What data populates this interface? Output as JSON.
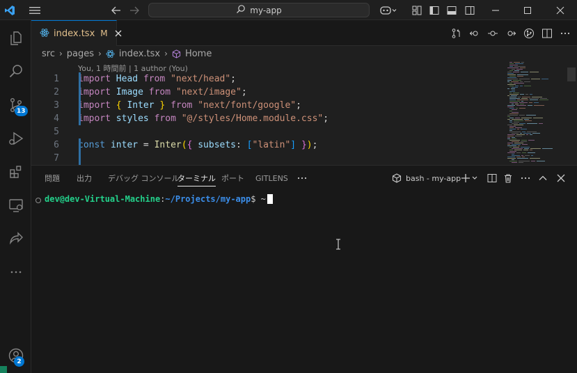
{
  "window": {
    "search_text": "my-app"
  },
  "activity": {
    "source_control_badge": "13",
    "accounts_badge": "2"
  },
  "tab": {
    "name": "index.tsx",
    "modified": "M"
  },
  "breadcrumb": {
    "items": [
      "src",
      "pages",
      "index.tsx",
      "Home"
    ]
  },
  "editor": {
    "codelens": "You, 1 時間前 | 1 author (You)",
    "line_numbers": [
      "1",
      "2",
      "3",
      "4",
      "5",
      "6",
      "7"
    ],
    "lines": [
      [
        [
          "kw2",
          "import"
        ],
        [
          "pl",
          " "
        ],
        [
          "id",
          "Head"
        ],
        [
          "pl",
          " "
        ],
        [
          "kw2",
          "from"
        ],
        [
          "pl",
          " "
        ],
        [
          "str",
          "\"next/head\""
        ],
        [
          "pl",
          ";"
        ]
      ],
      [
        [
          "kw2",
          "import"
        ],
        [
          "pl",
          " "
        ],
        [
          "id",
          "Image"
        ],
        [
          "pl",
          " "
        ],
        [
          "kw2",
          "from"
        ],
        [
          "pl",
          " "
        ],
        [
          "str",
          "\"next/image\""
        ],
        [
          "pl",
          ";"
        ]
      ],
      [
        [
          "kw2",
          "import"
        ],
        [
          "pl",
          " "
        ],
        [
          "br1",
          "{"
        ],
        [
          "pl",
          " "
        ],
        [
          "id",
          "Inter"
        ],
        [
          "pl",
          " "
        ],
        [
          "br1",
          "}"
        ],
        [
          "pl",
          " "
        ],
        [
          "kw2",
          "from"
        ],
        [
          "pl",
          " "
        ],
        [
          "str",
          "\"next/font/google\""
        ],
        [
          "pl",
          ";"
        ]
      ],
      [
        [
          "kw2",
          "import"
        ],
        [
          "pl",
          " "
        ],
        [
          "id",
          "styles"
        ],
        [
          "pl",
          " "
        ],
        [
          "kw2",
          "from"
        ],
        [
          "pl",
          " "
        ],
        [
          "str",
          "\"@/styles/Home.module.css\""
        ],
        [
          "pl",
          ";"
        ]
      ],
      [],
      [
        [
          "kw",
          "const"
        ],
        [
          "pl",
          " "
        ],
        [
          "id",
          "inter"
        ],
        [
          "pl",
          " = "
        ],
        [
          "fn",
          "Inter"
        ],
        [
          "br1",
          "("
        ],
        [
          "br2",
          "{"
        ],
        [
          "pl",
          " "
        ],
        [
          "id",
          "subsets"
        ],
        [
          "pl",
          ": "
        ],
        [
          "br3",
          "["
        ],
        [
          "str",
          "\"latin\""
        ],
        [
          "br3",
          "]"
        ],
        [
          "pl",
          " "
        ],
        [
          "br2",
          "}"
        ],
        [
          "br1",
          ")"
        ],
        [
          "pl",
          ";"
        ]
      ],
      []
    ]
  },
  "panel": {
    "tabs": [
      "問題",
      "出力",
      "デバッグ コンソール",
      "ターミナル",
      "ポート",
      "GITLENS"
    ],
    "active_tab": "ターミナル",
    "terminal_name": "bash - my-app"
  },
  "terminal": {
    "user_host": "dev@dev-Virtual-Machine",
    "colon": ":",
    "path": "~/Projects/my-app",
    "prompt_suffix": "$ ~"
  },
  "colors": {
    "accent": "#0078d4",
    "modified": "#e2c08d"
  }
}
